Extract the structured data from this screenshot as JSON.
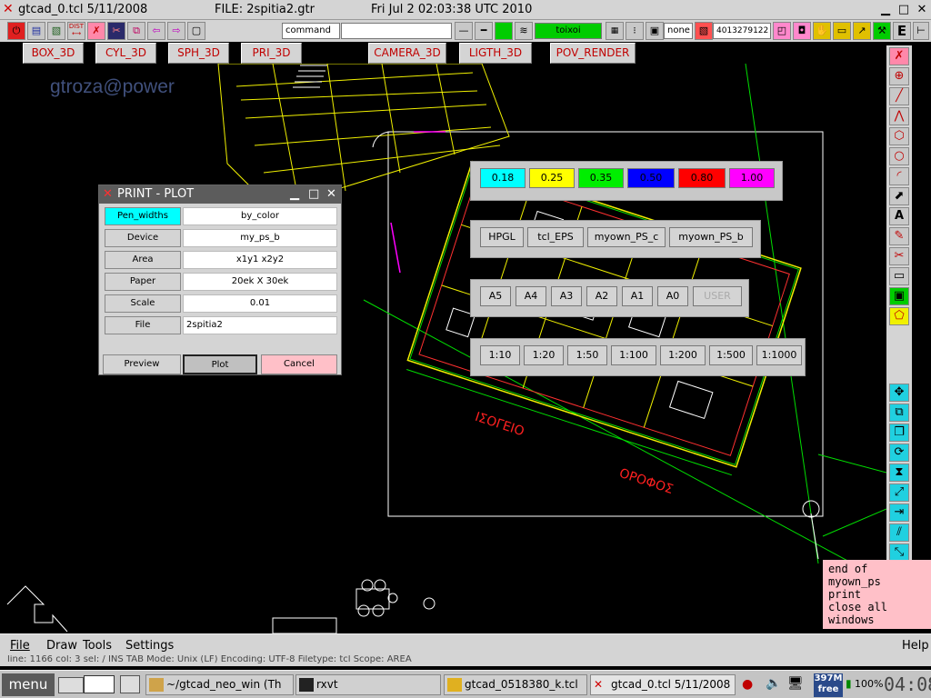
{
  "window": {
    "app_title": "gtcad_0.tcl 5/11/2008",
    "file_title": "FILE: 2spitia2.gtr",
    "datetime": "Fri Jul  2 02:03:38 UTC 2010"
  },
  "toolbar": {
    "dist_label": "DIST",
    "command_label": "command",
    "layer_name": "toixoi",
    "linetype_none": "none",
    "coord_value": "4013279122",
    "letter_e": "E"
  },
  "buttons_3d": [
    "BOX_3D",
    "CYL_3D",
    "SPH_3D",
    "PRI_3D",
    "CAMERA_3D",
    "LIGTH_3D",
    "POV_RENDER"
  ],
  "watermark": "gtroza@power",
  "drawing_labels": {
    "ground_floor": "ΙΣΟΓΕΙΟ",
    "floor": "ΟΡΟΦΟΣ"
  },
  "print_dialog": {
    "title": "PRINT - PLOT",
    "rows": [
      {
        "label": "Pen_widths",
        "value": "by_color"
      },
      {
        "label": "Device",
        "value": "my_ps_b"
      },
      {
        "label": "Area",
        "value": "x1y1 x2y2"
      },
      {
        "label": "Paper",
        "value": "20ek X 30ek"
      },
      {
        "label": "Scale",
        "value": "0.01"
      },
      {
        "label": "File",
        "value": "2spitia2"
      }
    ],
    "preview_label": "Preview",
    "plot_label": "Plot",
    "cancel_label": "Cancel"
  },
  "pen_widths": [
    {
      "label": "0.18",
      "color": "#00ffff"
    },
    {
      "label": "0.25",
      "color": "#ffff00"
    },
    {
      "label": "0.35",
      "color": "#00ee00"
    },
    {
      "label": "0.50",
      "color": "#0000ff"
    },
    {
      "label": "0.80",
      "color": "#ff0000"
    },
    {
      "label": "1.00",
      "color": "#ff00ff"
    }
  ],
  "devices": [
    "HPGL",
    "tcl_EPS",
    "myown_PS_c",
    "myown_PS_b"
  ],
  "papers": [
    "A5",
    "A4",
    "A3",
    "A2",
    "A1",
    "A0",
    "USER"
  ],
  "scales": [
    "1:10",
    "1:20",
    "1:50",
    "1:100",
    "1:200",
    "1:500",
    "1:1000"
  ],
  "console_lines": [
    "end of myown_ps",
    "print",
    "close all",
    "windows"
  ],
  "menu": {
    "file": "File",
    "draw": "Draw",
    "tools": "Tools",
    "settings": "Settings",
    "help": "Help"
  },
  "status_text": "line: 1166   col: 3   sel: /   INS   TAB   Mode: Unix (LF)   Encoding: UTF-8   Filetype: tcl   Scope: AREA",
  "taskbar": {
    "menu_label": "menu",
    "tasks": [
      "~/gtcad_neo_win (Th",
      "rxvt",
      "gtcad_0518380_k.tcl",
      "gtcad_0.tcl 5/11/2008"
    ],
    "memory_top": "397M",
    "memory_bottom": "free",
    "battery": "100%",
    "clock": "04:08"
  },
  "colors": {
    "accent_red": "#c00000",
    "cancel_pink": "#ffc0c8",
    "pen_cyan": "#00ffff",
    "layer_green": "#00cc00"
  }
}
